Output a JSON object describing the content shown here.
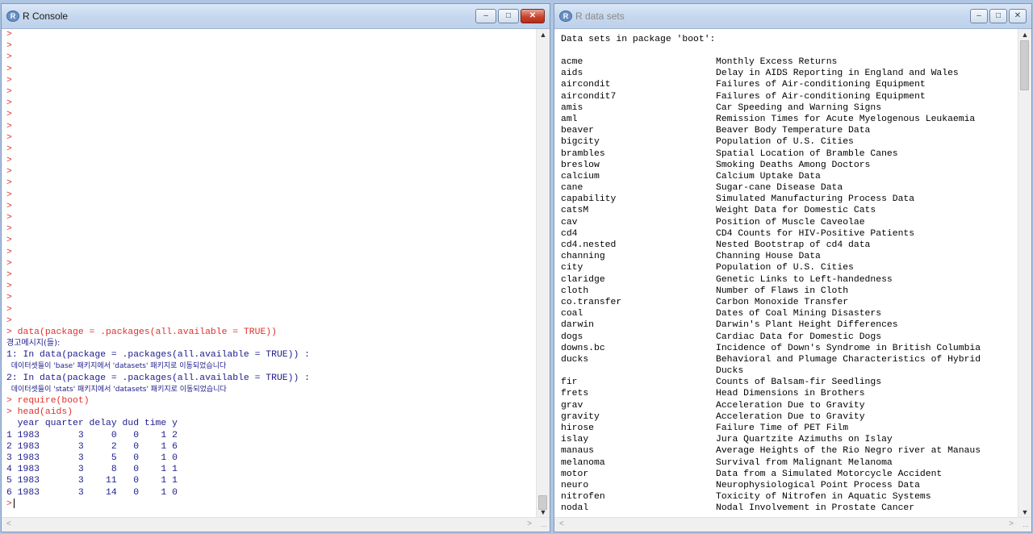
{
  "console": {
    "title": "R Console",
    "prompt": ">",
    "empty_prompt_count": 26,
    "lines": [
      {
        "type": "cmd",
        "text": " data(package = .packages(all.available = TRUE))"
      },
      {
        "type": "warnh",
        "text": "경고메시지(들):"
      },
      {
        "type": "out",
        "text": "1: In data(package = .packages(all.available = TRUE)) :"
      },
      {
        "type": "warn",
        "text": "  데이터셋들이 'base' 패키지에서 'datasets' 패키지로 이동되었습니다"
      },
      {
        "type": "out",
        "text": "2: In data(package = .packages(all.available = TRUE)) :"
      },
      {
        "type": "warn",
        "text": "  데이터셋들이 'stats' 패키지에서 'datasets' 패키지로 이동되었습니다"
      },
      {
        "type": "cmd",
        "text": " require(boot)"
      },
      {
        "type": "cmd",
        "text": " head(aids)"
      },
      {
        "type": "out",
        "text": "  year quarter delay dud time y"
      },
      {
        "type": "out",
        "text": "1 1983       3     0   0    1 2"
      },
      {
        "type": "out",
        "text": "2 1983       3     2   0    1 6"
      },
      {
        "type": "out",
        "text": "3 1983       3     5   0    1 0"
      },
      {
        "type": "out",
        "text": "4 1983       3     8   0    1 1"
      },
      {
        "type": "out",
        "text": "5 1983       3    11   0    1 1"
      },
      {
        "type": "out",
        "text": "6 1983       3    14   0    1 0"
      }
    ]
  },
  "datasets": {
    "title": "R data sets",
    "header": "Data sets in package 'boot':",
    "rows": [
      {
        "name": "acme",
        "desc": "Monthly Excess Returns"
      },
      {
        "name": "aids",
        "desc": "Delay in AIDS Reporting in England and Wales"
      },
      {
        "name": "aircondit",
        "desc": "Failures of Air-conditioning Equipment"
      },
      {
        "name": "aircondit7",
        "desc": "Failures of Air-conditioning Equipment"
      },
      {
        "name": "amis",
        "desc": "Car Speeding and Warning Signs"
      },
      {
        "name": "aml",
        "desc": "Remission Times for Acute Myelogenous Leukaemia"
      },
      {
        "name": "beaver",
        "desc": "Beaver Body Temperature Data"
      },
      {
        "name": "bigcity",
        "desc": "Population of U.S. Cities"
      },
      {
        "name": "brambles",
        "desc": "Spatial Location of Bramble Canes"
      },
      {
        "name": "breslow",
        "desc": "Smoking Deaths Among Doctors"
      },
      {
        "name": "calcium",
        "desc": "Calcium Uptake Data"
      },
      {
        "name": "cane",
        "desc": "Sugar-cane Disease Data"
      },
      {
        "name": "capability",
        "desc": "Simulated Manufacturing Process Data"
      },
      {
        "name": "catsM",
        "desc": "Weight Data for Domestic Cats"
      },
      {
        "name": "cav",
        "desc": "Position of Muscle Caveolae"
      },
      {
        "name": "cd4",
        "desc": "CD4 Counts for HIV-Positive Patients"
      },
      {
        "name": "cd4.nested",
        "desc": "Nested Bootstrap of cd4 data"
      },
      {
        "name": "channing",
        "desc": "Channing House Data"
      },
      {
        "name": "city",
        "desc": "Population of U.S. Cities"
      },
      {
        "name": "claridge",
        "desc": "Genetic Links to Left-handedness"
      },
      {
        "name": "cloth",
        "desc": "Number of Flaws in Cloth"
      },
      {
        "name": "co.transfer",
        "desc": "Carbon Monoxide Transfer"
      },
      {
        "name": "coal",
        "desc": "Dates of Coal Mining Disasters"
      },
      {
        "name": "darwin",
        "desc": "Darwin's Plant Height Differences"
      },
      {
        "name": "dogs",
        "desc": "Cardiac Data for Domestic Dogs"
      },
      {
        "name": "downs.bc",
        "desc": "Incidence of Down's Syndrome in British Columbia"
      },
      {
        "name": "ducks",
        "desc": "Behavioral and Plumage Characteristics of Hybrid"
      },
      {
        "name": "",
        "desc": "Ducks"
      },
      {
        "name": "fir",
        "desc": "Counts of Balsam-fir Seedlings"
      },
      {
        "name": "frets",
        "desc": "Head Dimensions in Brothers"
      },
      {
        "name": "grav",
        "desc": "Acceleration Due to Gravity"
      },
      {
        "name": "gravity",
        "desc": "Acceleration Due to Gravity"
      },
      {
        "name": "hirose",
        "desc": "Failure Time of PET Film"
      },
      {
        "name": "islay",
        "desc": "Jura Quartzite Azimuths on Islay"
      },
      {
        "name": "manaus",
        "desc": "Average Heights of the Rio Negro river at Manaus"
      },
      {
        "name": "melanoma",
        "desc": "Survival from Malignant Melanoma"
      },
      {
        "name": "motor",
        "desc": "Data from a Simulated Motorcycle Accident"
      },
      {
        "name": "neuro",
        "desc": "Neurophysiological Point Process Data"
      },
      {
        "name": "nitrofen",
        "desc": "Toxicity of Nitrofen in Aquatic Systems"
      },
      {
        "name": "nodal",
        "desc": "Nodal Involvement in Prostate Cancer"
      }
    ]
  }
}
